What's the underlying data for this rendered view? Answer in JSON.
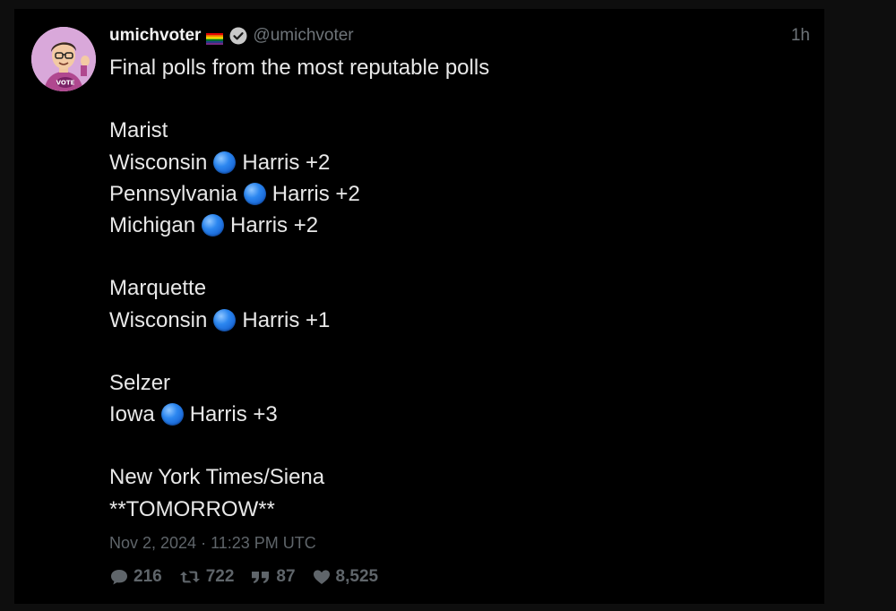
{
  "tweet": {
    "display_name": "umichvoter",
    "handle": "@umichvoter",
    "time_ago": "1h",
    "avatar_icon": "avatar-cartoon-vote-shirt-icon",
    "flag_icon": "rainbow-flag-icon",
    "verified_icon": "verified-badge-icon",
    "intro": "Final polls from the most reputable polls",
    "sections": [
      {
        "pollster": "Marist",
        "results": [
          {
            "state": "Wisconsin",
            "candidate": "Harris +2"
          },
          {
            "state": "Pennsylvania",
            "candidate": "Harris +2"
          },
          {
            "state": "Michigan",
            "candidate": "Harris +2"
          }
        ]
      },
      {
        "pollster": "Marquette",
        "results": [
          {
            "state": "Wisconsin",
            "candidate": "Harris +1"
          }
        ]
      },
      {
        "pollster": "Selzer",
        "results": [
          {
            "state": "Iowa",
            "candidate": "Harris +3"
          }
        ]
      }
    ],
    "final_pollster": "New York Times/Siena",
    "final_note": "**TOMORROW**",
    "timestamp": "Nov 2, 2024 · 11:23 PM UTC",
    "stats": {
      "replies": "216",
      "retweets": "722",
      "quotes": "87",
      "likes": "8,525"
    }
  },
  "colors": {
    "background": "#000000",
    "text": "#e8e8e8",
    "muted": "#6e7479",
    "dot": "#2c87f0"
  }
}
